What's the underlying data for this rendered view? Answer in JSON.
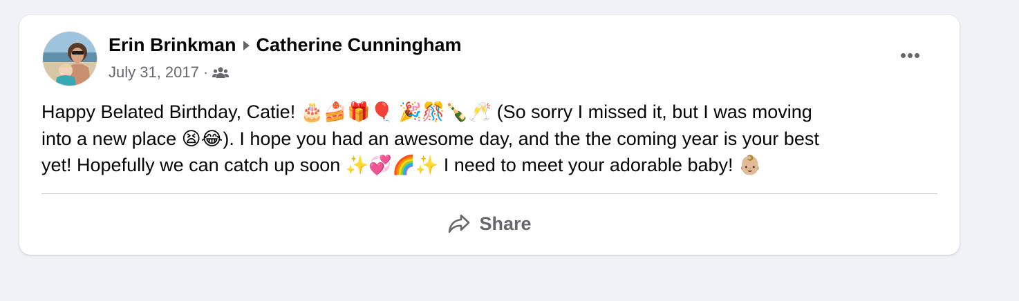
{
  "post": {
    "author": "Erin Brinkman",
    "recipient": "Catherine Cunningham",
    "date": "July 31, 2017",
    "separator": "·",
    "audience_icon": "friends-icon",
    "more_icon": "more-options-icon",
    "body_lines": [
      "Happy Belated Birthday, Catie! 🎂🍰🎁🎈 🎉🎊🍾🥂 (So sorry I missed it, but I was moving",
      "into a new place 😫😂). I hope you had an awesome day, and the the coming year is your best",
      "yet! Hopefully we can catch up soon ✨💞🌈✨ I need to meet your adorable baby! 👶🏼"
    ]
  },
  "actions": {
    "share_label": "Share",
    "share_icon": "share-arrow-icon"
  },
  "colors": {
    "background": "#f0f2f5",
    "card": "#ffffff",
    "primary_text": "#050505",
    "secondary_text": "#65676b",
    "divider": "#ced0d4"
  }
}
